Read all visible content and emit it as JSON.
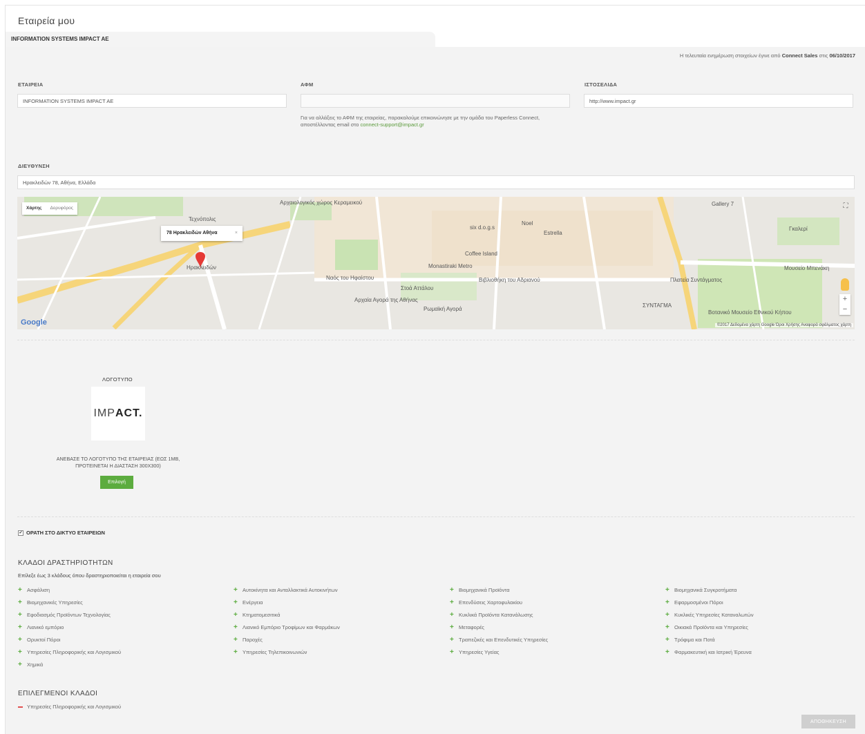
{
  "page": {
    "title": "Εταιρεία μου"
  },
  "tab": {
    "label": "INFORMATION SYSTEMS IMPACT AE"
  },
  "last_update": {
    "prefix": "Η τελευταία ενημέρωση στοιχείων έγινε από",
    "by": "Connect Sales",
    "mid": "στις",
    "date": "06/10/2017"
  },
  "company": {
    "label": "ΕΤΑΙΡΕΙΑ",
    "value": "INFORMATION SYSTEMS IMPACT AE"
  },
  "afm": {
    "label": "ΑΦΜ",
    "value": "",
    "help_text": "Για να αλλάξεις το ΑΦΜ της εταιρείας, παρακαλούμε επικοινώνησε με την ομάδα του Paperless Connect, αποστέλλοντας email στο",
    "help_email": "connect-support@impact.gr"
  },
  "website": {
    "label": "ΙΣΤΟΣΕΛΙΔΑ",
    "value": "http://www.impact.gr"
  },
  "address": {
    "label": "ΔΙΕΥΘΥΝΣΗ",
    "value": "Ηρακλειδών 78, Αθήνα, Ελλάδα"
  },
  "map": {
    "toggle_map": "Χάρτης",
    "toggle_satellite": "Δορυφόρος",
    "marker_label": "78 Ηρακλειδών Αθήνα",
    "close": "×",
    "google": "Google",
    "footer": "©2017 Δεδομένα χάρτη Google   Όροι Χρήσης   Αναφορά σφάλματος χάρτη",
    "pois": [
      "Αρχαιολογικός χώρος Κεραμεικού",
      "Τεχνόπολις",
      "Ηρακλειδών",
      "Ναός του Ηφαίστου",
      "Στοά Αττάλου",
      "Αρχαία Αγορά της Αθήνας",
      "Ρωμαϊκή Αγορά",
      "Coffee Island",
      "Βιβλιοθήκη του Αδριανού",
      "six d.o.g.s",
      "Noel",
      "Estrella",
      "Πλατεία Συντάγματος",
      "Μουσείο Μπενάκη",
      "Gallery 7",
      "Γκαλερί",
      "Βοτανικό Μουσείο Εθνικού Κήπου",
      "Monastiraki Metro",
      "ΣΥΝΤΑΓΜΑ"
    ]
  },
  "logo": {
    "title": "ΛΟΓΟΤΥΠΟ",
    "brand_light": "IMP",
    "brand_bold": "ACT.",
    "upload_text": "ΑΝΕΒΑΣΕ ΤΟ ΛΟΓΟΤΥΠΟ ΤΗΣ ΕΤΑΙΡΕΙΑΣ (ΕΩΣ 1MB, ΠΡΟΤΕΙΝΕΤΑΙ Η ΔΙΑΣΤΑΣΗ 300Χ300)",
    "choose_label": "Επιλογή"
  },
  "visible": {
    "label": "ΟΡΑΤΗ ΣΤΟ ΔΙΚΤΥΟ ΕΤΑΙΡΕΙΩΝ",
    "checked": true
  },
  "sectors": {
    "title": "ΚΛΑΔΟΙ ΔΡΑΣΤΗΡΙΟΤΗΤΩΝ",
    "note": "Επίλεξε έως 3 κλάδους όπου δραστηριοποιείται η εταιρεία σου",
    "columns": [
      [
        "Ασφάλιση",
        "Βιομηχανικές Υπηρεσίες",
        "Εφοδιασμός Προϊόντων Τεχνολογίας",
        "Λιανικό εμπόριο",
        "Ορυκτοί Πόροι",
        "Υπηρεσίες Πληροφορικής και Λογισμικού",
        "Χημικά"
      ],
      [
        "Αυτοκίνητα και Ανταλλακτικά Αυτοκινήτων",
        "Ενέργεια",
        "Κτηματομεσιτικά",
        "Λιανικό Εμπόριο Τροφίμων και Φαρμάκων",
        "Παροχές",
        "Υπηρεσίες Τηλεπικοινωνιών"
      ],
      [
        "Βιομηχανικά Προϊόντα",
        "Επενδύσεις Χαρτοφυλακίου",
        "Κυκλικά Προϊόντα Κατανάλωσης",
        "Μεταφορές",
        "Τραπεζικές και Επενδυτικές Υπηρεσίες",
        "Υπηρεσίες Υγείας"
      ],
      [
        "Βιομηχανικά Συγκροτήματα",
        "Εφαρμοσμένοι Πόροι",
        "Κυκλικές Υπηρεσίες Καταναλωτών",
        "Οικιακά Προϊόντα και Υπηρεσίες",
        "Τρόφιμα και Ποτά",
        "Φαρμακευτική και Ιατρική Έρευνα"
      ]
    ]
  },
  "selected": {
    "title": "ΕΠΙΛΕΓΜΕΝΟΙ ΚΛΑΔΟΙ",
    "items": [
      "Υπηρεσίες Πληροφορικής και Λογισμικού"
    ]
  },
  "save": {
    "label": "ΑΠΟΘΗΚΕΥΣΗ"
  },
  "colors": {
    "accent_green": "#5cac3f",
    "remove_red": "#e05050",
    "panel_bg": "#f3f3f3",
    "save_disabled": "#cfcfcf"
  }
}
